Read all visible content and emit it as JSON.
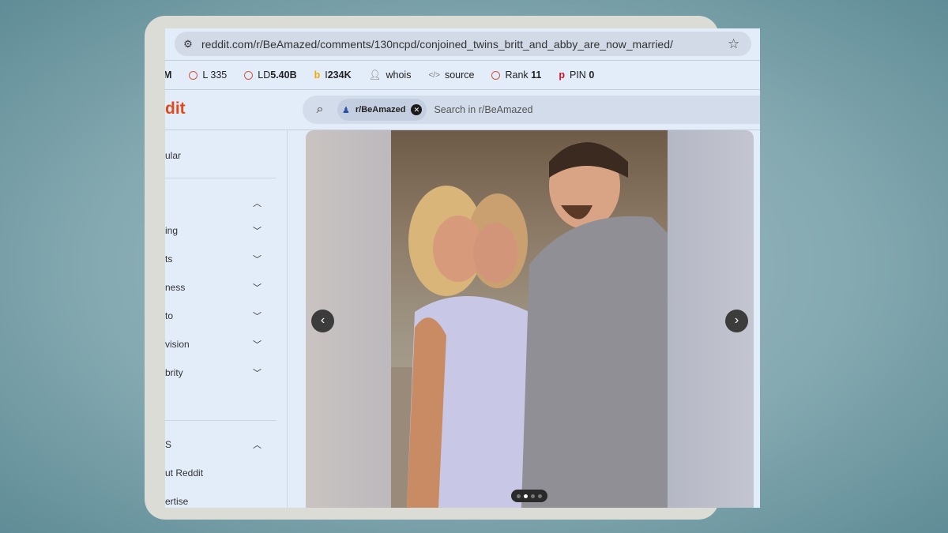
{
  "browser": {
    "url": "reddit.com/r/BeAmazed/comments/130ncpd/conjoined_twins_britt_and_abby_are_now_married/",
    "icons": {
      "site_settings": "tune-icon",
      "bookmark": "star-icon"
    }
  },
  "extensions": [
    {
      "label": "M",
      "icon": ""
    },
    {
      "label": "L",
      "value": "335",
      "icon": "ring-icon"
    },
    {
      "label": "LD",
      "value": "5.40B",
      "icon": "ring-icon"
    },
    {
      "label": "I",
      "value": "234K",
      "icon": "bing-icon"
    },
    {
      "label": "whois",
      "icon": "person-icon"
    },
    {
      "label": "source",
      "icon": "code-icon"
    },
    {
      "label": "Rank",
      "value": "11",
      "icon": "ring-icon"
    },
    {
      "label": "PIN",
      "value": "0",
      "icon": "pinterest-icon"
    }
  ],
  "header": {
    "logo": "dit",
    "search_chip": "r/BeAmazed",
    "search_placeholder": "Search in r/BeAmazed",
    "brand_color": "#e0491a"
  },
  "sidebar": {
    "items": [
      {
        "label": "ular"
      },
      {
        "label": "",
        "chevron": "up"
      },
      {
        "label": "ing",
        "chevron": "down"
      },
      {
        "label": "ts",
        "chevron": "down"
      },
      {
        "label": "ness",
        "chevron": "down"
      },
      {
        "label": "to",
        "chevron": "down"
      },
      {
        "label": "vision",
        "chevron": "down"
      },
      {
        "label": "brity",
        "chevron": "down"
      },
      {
        "label": "S",
        "chevron": "up"
      },
      {
        "label": "ut Reddit"
      },
      {
        "label": "ertise"
      }
    ]
  },
  "carousel": {
    "current_index": 2,
    "total": 4,
    "prev": "‹",
    "next": "›"
  }
}
